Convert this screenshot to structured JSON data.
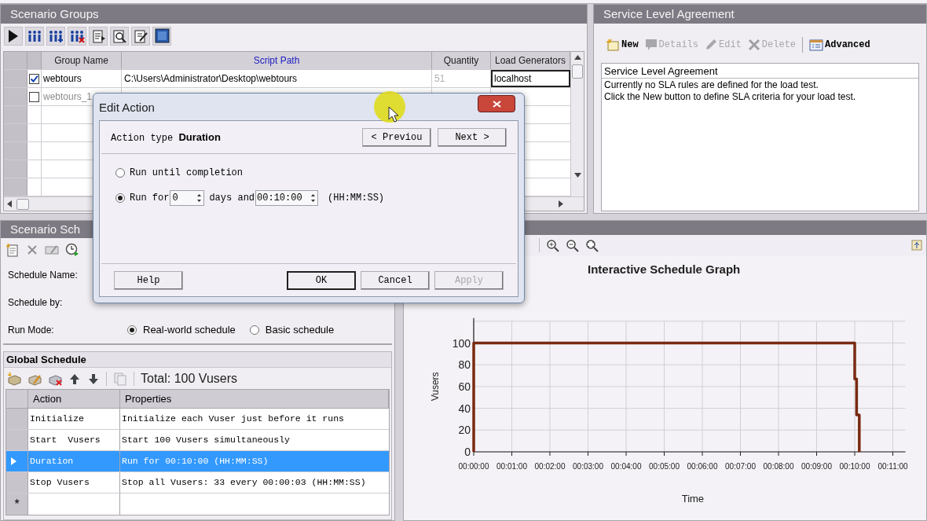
{
  "scenario_groups": {
    "title": "Scenario Groups",
    "columns": [
      {
        "label": "Group Name",
        "sorted": false
      },
      {
        "label": "Script Path",
        "sorted": true
      },
      {
        "label": "Quantity",
        "sorted": false
      },
      {
        "label": "Load Generators",
        "sorted": false
      }
    ],
    "rows": [
      {
        "checked": true,
        "enabled": true,
        "group_name": "webtours",
        "script_path": "C:\\Users\\Administrator\\Desktop\\webtours",
        "quantity": "51",
        "load_generators": "localhost"
      },
      {
        "checked": false,
        "enabled": false,
        "group_name": "webtours_1"
      }
    ]
  },
  "sla": {
    "title": "Service Level Agreement",
    "toolbar": [
      {
        "label": "New",
        "disabled": false
      },
      {
        "label": "Details",
        "disabled": true
      },
      {
        "label": "Edit",
        "disabled": true
      },
      {
        "label": "Delete",
        "disabled": true
      },
      {
        "label": "Advanced",
        "disabled": false
      }
    ],
    "list": {
      "header": "Service Level Agreement",
      "lines": [
        "Currently no SLA rules are defined for the load test.",
        "Click the New button to define SLA criteria for your load test."
      ]
    }
  },
  "schedule": {
    "title": "Scenario Sch",
    "schedule_name_label": "Schedule Name:",
    "schedule_by_label": "Schedule by:",
    "run_mode": {
      "label": "Run Mode:",
      "options": [
        {
          "label": "Real-world schedule",
          "selected": true
        },
        {
          "label": "Basic schedule",
          "selected": false
        }
      ]
    },
    "global_schedule": {
      "title": "Global Schedule",
      "total": "Total: 100 Vusers",
      "columns": [
        "Action",
        "Properties"
      ],
      "rows": [
        {
          "action": "Initialize",
          "properties": "Initialize each Vuser just before it runs",
          "selected": false
        },
        {
          "action": "Start  Vusers",
          "properties": "Start 100 Vusers simultaneously",
          "selected": false
        },
        {
          "action": "Duration",
          "properties": "Run for 00:10:00 (HH:MM:SS)",
          "selected": true
        },
        {
          "action": "Stop Vusers",
          "properties": "Stop all Vusers: 33 every 00:00:03 (HH:MM:SS)",
          "selected": false
        }
      ],
      "new_row_marker": "*"
    }
  },
  "graph": {
    "chart_data": {
      "type": "line",
      "title": "Interactive Schedule Graph",
      "xlabel": "Time",
      "ylabel": "Vusers",
      "x": [
        0,
        0,
        10,
        10,
        10.05,
        10.05,
        10.12,
        10.12
      ],
      "series": [
        {
          "color": "#7a2a12",
          "values": [
            0,
            100,
            100,
            67,
            67,
            34,
            34,
            0
          ]
        }
      ],
      "xlim": [
        0,
        11
      ],
      "ylim": [
        0,
        120
      ],
      "xticks": [
        {
          "value": 0,
          "label": "00:00:00"
        },
        {
          "value": 1,
          "label": "00:01:00"
        },
        {
          "value": 2,
          "label": "00:02:00"
        },
        {
          "value": 3,
          "label": "00:03:00"
        },
        {
          "value": 4,
          "label": "00:04:00"
        },
        {
          "value": 5,
          "label": "00:05:00"
        },
        {
          "value": 6,
          "label": "00:06:00"
        },
        {
          "value": 7,
          "label": "00:07:00"
        },
        {
          "value": 8,
          "label": "00:08:00"
        },
        {
          "value": 9,
          "label": "00:09:00"
        },
        {
          "value": 10,
          "label": "00:10:00"
        },
        {
          "value": 11,
          "label": "00:11:00"
        }
      ],
      "yticks": [
        0,
        20,
        40,
        60,
        80,
        100
      ],
      "grid": true
    }
  },
  "dialog": {
    "title": "Edit Action",
    "action_type": "Action type **Duration**",
    "nav_buttons": [
      "< Previou",
      "Next >"
    ],
    "options": [
      {
        "kind": "completion",
        "label": "Run until completion",
        "selected": false
      },
      {
        "kind": "duration",
        "label": "Run for",
        "selected": true,
        "days": "0",
        "days_label": "days and",
        "time": "00:10:00",
        "format": "(HH:MM:SS)"
      }
    ],
    "buttons": [
      {
        "label": "Help",
        "default": false,
        "disabled": false
      },
      {
        "label": "OK",
        "default": true,
        "disabled": false
      },
      {
        "label": "Cancel",
        "default": false,
        "disabled": false
      },
      {
        "label": "Apply",
        "default": false,
        "disabled": true
      }
    ]
  }
}
